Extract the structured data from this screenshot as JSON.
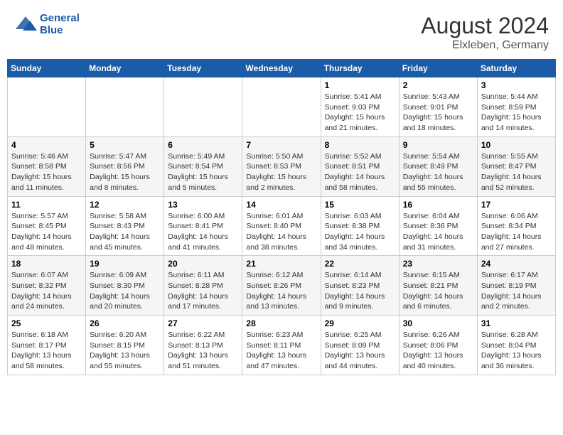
{
  "header": {
    "logo_line1": "General",
    "logo_line2": "Blue",
    "month_year": "August 2024",
    "location": "Elxleben, Germany"
  },
  "weekdays": [
    "Sunday",
    "Monday",
    "Tuesday",
    "Wednesday",
    "Thursday",
    "Friday",
    "Saturday"
  ],
  "weeks": [
    [
      {
        "day": "",
        "info": ""
      },
      {
        "day": "",
        "info": ""
      },
      {
        "day": "",
        "info": ""
      },
      {
        "day": "",
        "info": ""
      },
      {
        "day": "1",
        "info": "Sunrise: 5:41 AM\nSunset: 9:03 PM\nDaylight: 15 hours\nand 21 minutes."
      },
      {
        "day": "2",
        "info": "Sunrise: 5:43 AM\nSunset: 9:01 PM\nDaylight: 15 hours\nand 18 minutes."
      },
      {
        "day": "3",
        "info": "Sunrise: 5:44 AM\nSunset: 8:59 PM\nDaylight: 15 hours\nand 14 minutes."
      }
    ],
    [
      {
        "day": "4",
        "info": "Sunrise: 5:46 AM\nSunset: 8:58 PM\nDaylight: 15 hours\nand 11 minutes."
      },
      {
        "day": "5",
        "info": "Sunrise: 5:47 AM\nSunset: 8:56 PM\nDaylight: 15 hours\nand 8 minutes."
      },
      {
        "day": "6",
        "info": "Sunrise: 5:49 AM\nSunset: 8:54 PM\nDaylight: 15 hours\nand 5 minutes."
      },
      {
        "day": "7",
        "info": "Sunrise: 5:50 AM\nSunset: 8:53 PM\nDaylight: 15 hours\nand 2 minutes."
      },
      {
        "day": "8",
        "info": "Sunrise: 5:52 AM\nSunset: 8:51 PM\nDaylight: 14 hours\nand 58 minutes."
      },
      {
        "day": "9",
        "info": "Sunrise: 5:54 AM\nSunset: 8:49 PM\nDaylight: 14 hours\nand 55 minutes."
      },
      {
        "day": "10",
        "info": "Sunrise: 5:55 AM\nSunset: 8:47 PM\nDaylight: 14 hours\nand 52 minutes."
      }
    ],
    [
      {
        "day": "11",
        "info": "Sunrise: 5:57 AM\nSunset: 8:45 PM\nDaylight: 14 hours\nand 48 minutes."
      },
      {
        "day": "12",
        "info": "Sunrise: 5:58 AM\nSunset: 8:43 PM\nDaylight: 14 hours\nand 45 minutes."
      },
      {
        "day": "13",
        "info": "Sunrise: 6:00 AM\nSunset: 8:41 PM\nDaylight: 14 hours\nand 41 minutes."
      },
      {
        "day": "14",
        "info": "Sunrise: 6:01 AM\nSunset: 8:40 PM\nDaylight: 14 hours\nand 38 minutes."
      },
      {
        "day": "15",
        "info": "Sunrise: 6:03 AM\nSunset: 8:38 PM\nDaylight: 14 hours\nand 34 minutes."
      },
      {
        "day": "16",
        "info": "Sunrise: 6:04 AM\nSunset: 8:36 PM\nDaylight: 14 hours\nand 31 minutes."
      },
      {
        "day": "17",
        "info": "Sunrise: 6:06 AM\nSunset: 8:34 PM\nDaylight: 14 hours\nand 27 minutes."
      }
    ],
    [
      {
        "day": "18",
        "info": "Sunrise: 6:07 AM\nSunset: 8:32 PM\nDaylight: 14 hours\nand 24 minutes."
      },
      {
        "day": "19",
        "info": "Sunrise: 6:09 AM\nSunset: 8:30 PM\nDaylight: 14 hours\nand 20 minutes."
      },
      {
        "day": "20",
        "info": "Sunrise: 6:11 AM\nSunset: 8:28 PM\nDaylight: 14 hours\nand 17 minutes."
      },
      {
        "day": "21",
        "info": "Sunrise: 6:12 AM\nSunset: 8:26 PM\nDaylight: 14 hours\nand 13 minutes."
      },
      {
        "day": "22",
        "info": "Sunrise: 6:14 AM\nSunset: 8:23 PM\nDaylight: 14 hours\nand 9 minutes."
      },
      {
        "day": "23",
        "info": "Sunrise: 6:15 AM\nSunset: 8:21 PM\nDaylight: 14 hours\nand 6 minutes."
      },
      {
        "day": "24",
        "info": "Sunrise: 6:17 AM\nSunset: 8:19 PM\nDaylight: 14 hours\nand 2 minutes."
      }
    ],
    [
      {
        "day": "25",
        "info": "Sunrise: 6:18 AM\nSunset: 8:17 PM\nDaylight: 13 hours\nand 58 minutes."
      },
      {
        "day": "26",
        "info": "Sunrise: 6:20 AM\nSunset: 8:15 PM\nDaylight: 13 hours\nand 55 minutes."
      },
      {
        "day": "27",
        "info": "Sunrise: 6:22 AM\nSunset: 8:13 PM\nDaylight: 13 hours\nand 51 minutes."
      },
      {
        "day": "28",
        "info": "Sunrise: 6:23 AM\nSunset: 8:11 PM\nDaylight: 13 hours\nand 47 minutes."
      },
      {
        "day": "29",
        "info": "Sunrise: 6:25 AM\nSunset: 8:09 PM\nDaylight: 13 hours\nand 44 minutes."
      },
      {
        "day": "30",
        "info": "Sunrise: 6:26 AM\nSunset: 8:06 PM\nDaylight: 13 hours\nand 40 minutes."
      },
      {
        "day": "31",
        "info": "Sunrise: 6:28 AM\nSunset: 8:04 PM\nDaylight: 13 hours\nand 36 minutes."
      }
    ]
  ]
}
